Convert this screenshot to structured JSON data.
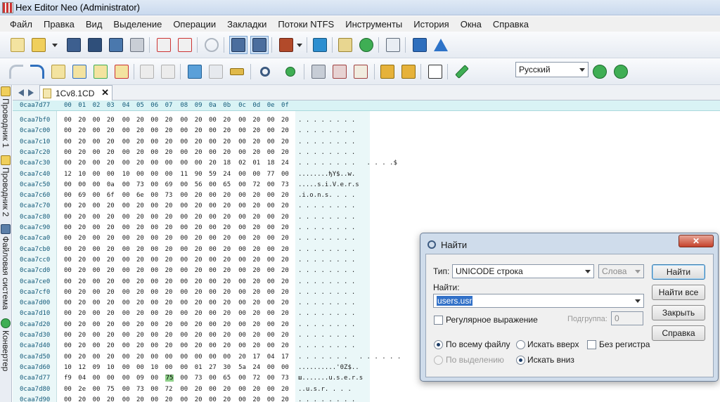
{
  "window": {
    "title": "Hex Editor Neo (Administrator)"
  },
  "menu": [
    "Файл",
    "Правка",
    "Вид",
    "Выделение",
    "Операции",
    "Закладки",
    "Потоки NTFS",
    "Инструменты",
    "История",
    "Окна",
    "Справка"
  ],
  "toolbar": {
    "language": "Русский"
  },
  "side_tabs": [
    {
      "label": "Проводник 1",
      "icon": "explorer-icon"
    },
    {
      "label": "Проводник 2",
      "icon": "explorer-icon"
    },
    {
      "label": "Файловая система",
      "icon": "filesystem-icon"
    },
    {
      "label": "Конвертер",
      "icon": "converter-icon"
    }
  ],
  "document_tab": {
    "label": "1Cv8.1CD",
    "close": "✕"
  },
  "hex": {
    "current_offset": "0caa7d77",
    "columns": [
      "00",
      "01",
      "02",
      "03",
      "04",
      "05",
      "06",
      "07",
      "08",
      "09",
      "0a",
      "0b",
      "0c",
      "0d",
      "0e",
      "0f"
    ],
    "rows": [
      {
        "offset": "0caa7bf0",
        "bytes": [
          "00",
          "20",
          "00",
          "20",
          "00",
          "20",
          "00",
          "20",
          "00",
          "20",
          "00",
          "20",
          "00",
          "20",
          "00",
          "20"
        ],
        "text": ". . . . . . . ."
      },
      {
        "offset": "0caa7c00",
        "bytes": [
          "00",
          "20",
          "00",
          "20",
          "00",
          "20",
          "00",
          "20",
          "00",
          "20",
          "00",
          "20",
          "00",
          "20",
          "00",
          "20"
        ],
        "text": ". . . . . . . ."
      },
      {
        "offset": "0caa7c10",
        "bytes": [
          "00",
          "20",
          "00",
          "20",
          "00",
          "20",
          "00",
          "20",
          "00",
          "20",
          "00",
          "20",
          "00",
          "20",
          "00",
          "20"
        ],
        "text": ". . . . . . . ."
      },
      {
        "offset": "0caa7c20",
        "bytes": [
          "00",
          "20",
          "00",
          "20",
          "00",
          "20",
          "00",
          "20",
          "00",
          "20",
          "00",
          "20",
          "00",
          "20",
          "00",
          "20"
        ],
        "text": ". . . . . . . ."
      },
      {
        "offset": "0caa7c30",
        "bytes": [
          "00",
          "20",
          "00",
          "20",
          "00",
          "20",
          "00",
          "00",
          "00",
          "00",
          "20",
          "18",
          "02",
          "01",
          "18",
          "24"
        ],
        "text": ". . . . . . . .   . . . .$"
      },
      {
        "offset": "0caa7c40",
        "bytes": [
          "12",
          "10",
          "00",
          "00",
          "10",
          "00",
          "00",
          "00",
          "11",
          "90",
          "59",
          "24",
          "00",
          "00",
          "77",
          "00"
        ],
        "text": "........ђY$..w."
      },
      {
        "offset": "0caa7c50",
        "bytes": [
          "00",
          "00",
          "00",
          "0a",
          "00",
          "73",
          "00",
          "69",
          "00",
          "56",
          "00",
          "65",
          "00",
          "72",
          "00",
          "73"
        ],
        "text": ".....s.i.V.e.r.s"
      },
      {
        "offset": "0caa7c60",
        "bytes": [
          "00",
          "69",
          "00",
          "6f",
          "00",
          "6e",
          "00",
          "73",
          "00",
          "20",
          "00",
          "20",
          "00",
          "20",
          "00",
          "20"
        ],
        "text": ".i.o.n.s. . . ."
      },
      {
        "offset": "0caa7c70",
        "bytes": [
          "00",
          "20",
          "00",
          "20",
          "00",
          "20",
          "00",
          "20",
          "00",
          "20",
          "00",
          "20",
          "00",
          "20",
          "00",
          "20"
        ],
        "text": ". . . . . . . ."
      },
      {
        "offset": "0caa7c80",
        "bytes": [
          "00",
          "20",
          "00",
          "20",
          "00",
          "20",
          "00",
          "20",
          "00",
          "20",
          "00",
          "20",
          "00",
          "20",
          "00",
          "20"
        ],
        "text": ". . . . . . . ."
      },
      {
        "offset": "0caa7c90",
        "bytes": [
          "00",
          "20",
          "00",
          "20",
          "00",
          "20",
          "00",
          "20",
          "00",
          "20",
          "00",
          "20",
          "00",
          "20",
          "00",
          "20"
        ],
        "text": ". . . . . . . ."
      },
      {
        "offset": "0caa7ca0",
        "bytes": [
          "00",
          "20",
          "00",
          "20",
          "00",
          "20",
          "00",
          "20",
          "00",
          "20",
          "00",
          "20",
          "00",
          "20",
          "00",
          "20"
        ],
        "text": ". . . . . . . ."
      },
      {
        "offset": "0caa7cb0",
        "bytes": [
          "00",
          "20",
          "00",
          "20",
          "00",
          "20",
          "00",
          "20",
          "00",
          "20",
          "00",
          "20",
          "00",
          "20",
          "00",
          "20"
        ],
        "text": ". . . . . . . ."
      },
      {
        "offset": "0caa7cc0",
        "bytes": [
          "00",
          "20",
          "00",
          "20",
          "00",
          "20",
          "00",
          "20",
          "00",
          "20",
          "00",
          "20",
          "00",
          "20",
          "00",
          "20"
        ],
        "text": ". . . . . . . ."
      },
      {
        "offset": "0caa7cd0",
        "bytes": [
          "00",
          "20",
          "00",
          "20",
          "00",
          "20",
          "00",
          "20",
          "00",
          "20",
          "00",
          "20",
          "00",
          "20",
          "00",
          "20"
        ],
        "text": ". . . . . . . ."
      },
      {
        "offset": "0caa7ce0",
        "bytes": [
          "00",
          "20",
          "00",
          "20",
          "00",
          "20",
          "00",
          "20",
          "00",
          "20",
          "00",
          "20",
          "00",
          "20",
          "00",
          "20"
        ],
        "text": ". . . . . . . ."
      },
      {
        "offset": "0caa7cf0",
        "bytes": [
          "00",
          "20",
          "00",
          "20",
          "00",
          "20",
          "00",
          "20",
          "00",
          "20",
          "00",
          "20",
          "00",
          "20",
          "00",
          "20"
        ],
        "text": ". . . . . . . ."
      },
      {
        "offset": "0caa7d00",
        "bytes": [
          "00",
          "20",
          "00",
          "20",
          "00",
          "20",
          "00",
          "20",
          "00",
          "20",
          "00",
          "20",
          "00",
          "20",
          "00",
          "20"
        ],
        "text": ". . . . . . . ."
      },
      {
        "offset": "0caa7d10",
        "bytes": [
          "00",
          "20",
          "00",
          "20",
          "00",
          "20",
          "00",
          "20",
          "00",
          "20",
          "00",
          "20",
          "00",
          "20",
          "00",
          "20"
        ],
        "text": ". . . . . . . ."
      },
      {
        "offset": "0caa7d20",
        "bytes": [
          "00",
          "20",
          "00",
          "20",
          "00",
          "20",
          "00",
          "20",
          "00",
          "20",
          "00",
          "20",
          "00",
          "20",
          "00",
          "20"
        ],
        "text": ". . . . . . . ."
      },
      {
        "offset": "0caa7d30",
        "bytes": [
          "00",
          "20",
          "00",
          "20",
          "00",
          "20",
          "00",
          "20",
          "00",
          "20",
          "00",
          "20",
          "00",
          "20",
          "00",
          "20"
        ],
        "text": ". . . . . . . ."
      },
      {
        "offset": "0caa7d40",
        "bytes": [
          "00",
          "20",
          "00",
          "20",
          "00",
          "20",
          "00",
          "20",
          "00",
          "20",
          "00",
          "20",
          "00",
          "20",
          "00",
          "20"
        ],
        "text": ". . . . . . . ."
      },
      {
        "offset": "0caa7d50",
        "bytes": [
          "00",
          "20",
          "00",
          "20",
          "00",
          "20",
          "00",
          "00",
          "00",
          "00",
          "00",
          "00",
          "20",
          "17",
          "04",
          "17"
        ],
        "text": ". . . . . . .   . . . . . ."
      },
      {
        "offset": "0caa7d60",
        "bytes": [
          "10",
          "12",
          "09",
          "10",
          "00",
          "00",
          "10",
          "00",
          "00",
          "01",
          "27",
          "30",
          "5a",
          "24",
          "00",
          "00"
        ],
        "text": "..........'0Z$.."
      },
      {
        "offset": "0caa7d77",
        "bytes": [
          "f9",
          "04",
          "00",
          "00",
          "00",
          "09",
          "00",
          "75",
          "00",
          "73",
          "00",
          "65",
          "00",
          "72",
          "00",
          "73"
        ],
        "text": "ш.......u.s.e.r.s",
        "selected": 7
      },
      {
        "offset": "0caa7d80",
        "bytes": [
          "00",
          "2e",
          "00",
          "75",
          "00",
          "73",
          "00",
          "72",
          "00",
          "20",
          "00",
          "20",
          "00",
          "20",
          "00",
          "20"
        ],
        "text": "..u.s.r. . . ."
      },
      {
        "offset": "0caa7d90",
        "bytes": [
          "00",
          "20",
          "00",
          "20",
          "00",
          "20",
          "00",
          "20",
          "00",
          "20",
          "00",
          "20",
          "00",
          "20",
          "00",
          "20"
        ],
        "text": ". . . . . . . ."
      }
    ]
  },
  "find_dialog": {
    "title": "Найти",
    "close": "✕",
    "type_label": "Тип:",
    "type_value": "UNICODE строка",
    "words_value": "Слова",
    "find_label": "Найти:",
    "find_value": "users.usr",
    "regex_label": "Регулярное выражение",
    "subgroup_label": "Подгруппа:",
    "subgroup_value": "0",
    "radio_whole_file": "По всему файлу",
    "radio_selection": "По выделению",
    "radio_up": "Искать вверх",
    "radio_down": "Искать вниз",
    "case_label": "Без регистра",
    "buttons": {
      "find": "Найти",
      "find_all": "Найти все",
      "close": "Закрыть",
      "help": "Справка"
    }
  },
  "colors": {
    "selection_byte": "#8fd18a",
    "hex_panel": "#eaf7f8",
    "header": "#d9f3f5",
    "dialog_frame": "#cfdceb",
    "close_button": "#c5432c"
  }
}
